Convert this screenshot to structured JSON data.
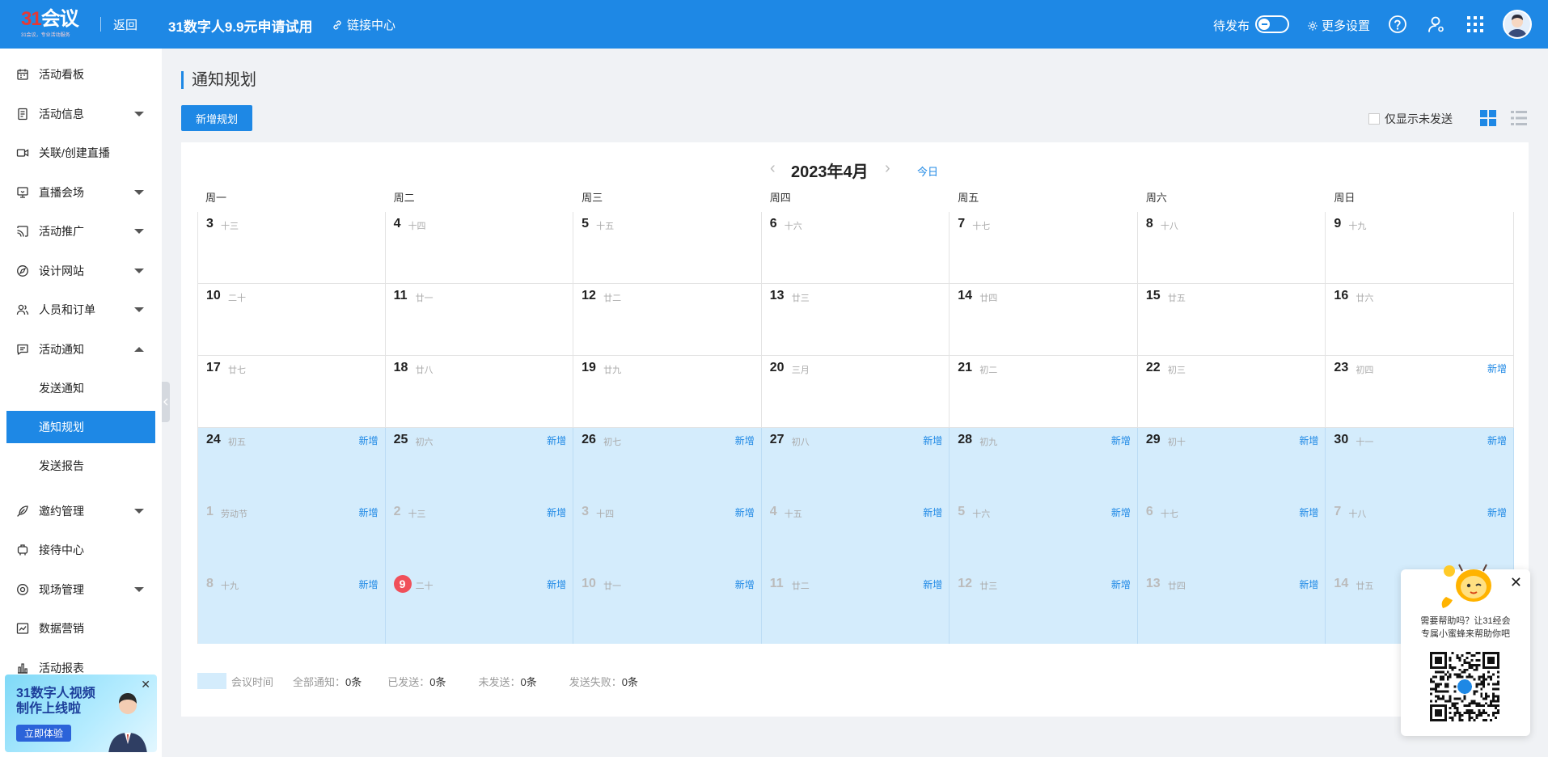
{
  "header": {
    "logo_number": "31",
    "logo_text": "会议",
    "logo_sub": "31会议，专业活动服务",
    "back": "返回",
    "promo": "31数字人9.9元申请试用",
    "link_center": "链接中心",
    "pending": "待发布",
    "more_settings": "更多设置"
  },
  "sidebar": {
    "items": [
      {
        "label": "活动看板",
        "icon": "calendar-icon",
        "caret": ""
      },
      {
        "label": "活动信息",
        "icon": "document-icon",
        "caret": "down"
      },
      {
        "label": "关联/创建直播",
        "icon": "video-icon",
        "caret": ""
      },
      {
        "label": "直播会场",
        "icon": "venue-icon",
        "caret": "down"
      },
      {
        "label": "活动推广",
        "icon": "cast-icon",
        "caret": "down"
      },
      {
        "label": "设计网站",
        "icon": "compass-icon",
        "caret": "down"
      },
      {
        "label": "人员和订单",
        "icon": "people-icon",
        "caret": "down"
      },
      {
        "label": "活动通知",
        "icon": "message-icon",
        "caret": "up"
      }
    ],
    "sub_items": [
      "发送通知",
      "通知规划",
      "发送报告"
    ],
    "active_sub": "通知规划",
    "items_after": [
      {
        "label": "邀约管理",
        "icon": "feather-icon",
        "caret": "down"
      },
      {
        "label": "接待中心",
        "icon": "reception-icon",
        "caret": ""
      },
      {
        "label": "现场管理",
        "icon": "target-icon",
        "caret": "down"
      },
      {
        "label": "数据营销",
        "icon": "chart-line-icon",
        "caret": ""
      },
      {
        "label": "活动报表",
        "icon": "bar-chart-icon",
        "caret": ""
      }
    ],
    "ad": {
      "title": "31数字人视频制作上线啦",
      "button": "立即体验"
    }
  },
  "main": {
    "title": "通知规划",
    "add_button": "新增规划",
    "only_unsent": "仅显示未发送",
    "calendar": {
      "month": "2023年4月",
      "today": "今日",
      "weekdays": [
        "周一",
        "周二",
        "周三",
        "周四",
        "周五",
        "周六",
        "周日"
      ],
      "add_label": "新增",
      "weeks": [
        [
          {
            "d": "3",
            "l": "十三"
          },
          {
            "d": "4",
            "l": "十四"
          },
          {
            "d": "5",
            "l": "十五"
          },
          {
            "d": "6",
            "l": "十六"
          },
          {
            "d": "7",
            "l": "十七"
          },
          {
            "d": "8",
            "l": "十八"
          },
          {
            "d": "9",
            "l": "十九"
          }
        ],
        [
          {
            "d": "10",
            "l": "二十"
          },
          {
            "d": "11",
            "l": "廿一"
          },
          {
            "d": "12",
            "l": "廿二"
          },
          {
            "d": "13",
            "l": "廿三"
          },
          {
            "d": "14",
            "l": "廿四"
          },
          {
            "d": "15",
            "l": "廿五"
          },
          {
            "d": "16",
            "l": "廿六"
          }
        ],
        [
          {
            "d": "17",
            "l": "廿七"
          },
          {
            "d": "18",
            "l": "廿八"
          },
          {
            "d": "19",
            "l": "廿九"
          },
          {
            "d": "20",
            "l": "三月"
          },
          {
            "d": "21",
            "l": "初二"
          },
          {
            "d": "22",
            "l": "初三"
          },
          {
            "d": "23",
            "l": "初四",
            "add": true
          }
        ],
        [
          {
            "d": "24",
            "l": "初五",
            "add": true,
            "hl": true
          },
          {
            "d": "25",
            "l": "初六",
            "add": true,
            "hl": true
          },
          {
            "d": "26",
            "l": "初七",
            "add": true,
            "hl": true
          },
          {
            "d": "27",
            "l": "初八",
            "add": true,
            "hl": true
          },
          {
            "d": "28",
            "l": "初九",
            "add": true,
            "hl": true
          },
          {
            "d": "29",
            "l": "初十",
            "add": true,
            "hl": true
          },
          {
            "d": "30",
            "l": "十一",
            "add": true,
            "hl": true
          }
        ],
        [
          {
            "d": "1",
            "l": "劳动节",
            "add": true,
            "hl": true,
            "other": true
          },
          {
            "d": "2",
            "l": "十三",
            "add": true,
            "hl": true,
            "other": true
          },
          {
            "d": "3",
            "l": "十四",
            "add": true,
            "hl": true,
            "other": true
          },
          {
            "d": "4",
            "l": "十五",
            "add": true,
            "hl": true,
            "other": true
          },
          {
            "d": "5",
            "l": "十六",
            "add": true,
            "hl": true,
            "other": true
          },
          {
            "d": "6",
            "l": "十七",
            "add": true,
            "hl": true,
            "other": true
          },
          {
            "d": "7",
            "l": "十八",
            "add": true,
            "hl": true,
            "other": true
          }
        ],
        [
          {
            "d": "8",
            "l": "十九",
            "add": true,
            "hl": true,
            "other": true
          },
          {
            "d": "9",
            "l": "二十",
            "add": true,
            "hl": true,
            "other": true,
            "today": true
          },
          {
            "d": "10",
            "l": "廿一",
            "add": true,
            "hl": true,
            "other": true
          },
          {
            "d": "11",
            "l": "廿二",
            "add": true,
            "hl": true,
            "other": true
          },
          {
            "d": "12",
            "l": "廿三",
            "add": true,
            "hl": true,
            "other": true
          },
          {
            "d": "13",
            "l": "廿四",
            "add": true,
            "hl": true,
            "other": true
          },
          {
            "d": "14",
            "l": "廿五",
            "add": false,
            "hl": true,
            "other": true
          }
        ]
      ]
    },
    "legend": {
      "swatch_label": "会议时间",
      "stats": [
        {
          "k": "全部通知：",
          "v": "0条"
        },
        {
          "k": "已发送：",
          "v": "0条"
        },
        {
          "k": "未发送：",
          "v": "0条"
        },
        {
          "k": "发送失败：",
          "v": "0条"
        }
      ]
    }
  },
  "help": {
    "line1": "需要帮助吗？让31经会",
    "line2": "专属小蜜蜂来帮助你吧"
  },
  "colors": {
    "primary": "#1e88e5",
    "highlight": "#d4ecfc",
    "today": "#f0505a"
  }
}
